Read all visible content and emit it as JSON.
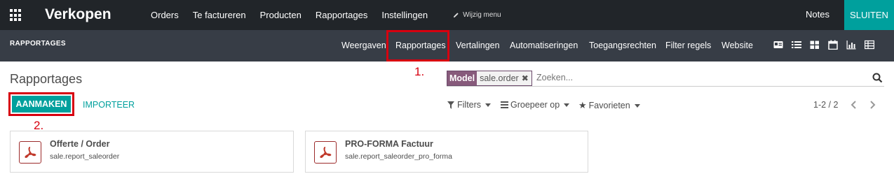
{
  "topbar": {
    "app_name": "Verkopen",
    "menu": [
      "Orders",
      "Te factureren",
      "Producten",
      "Rapportages",
      "Instellingen"
    ],
    "edit_menu": "Wijzig menu",
    "notes": "Notes",
    "close": "SLUITEN"
  },
  "subbar": {
    "title": "RAPPORTAGES",
    "nav": [
      "Weergaven",
      "Rapportages",
      "Vertalingen",
      "Automatiseringen",
      "Toegangsrechten",
      "Filter regels",
      "Website"
    ],
    "view_icons": [
      "contact-card-icon",
      "list-icon",
      "kanban-icon",
      "calendar-icon",
      "graph-icon",
      "pivot-icon"
    ]
  },
  "annotations": {
    "one": "1.",
    "two": "2."
  },
  "control": {
    "title": "Rapportages",
    "facet_label": "Model",
    "facet_value": "sale.order",
    "search_placeholder": "Zoeken...",
    "create": "AANMAKEN",
    "import": "IMPORTEER",
    "filters": "Filters",
    "group_by": "Groepeer op",
    "favorites": "Favorieten",
    "pager": "1-2 / 2"
  },
  "records": [
    {
      "name": "Offerte / Order",
      "report": "sale.report_saleorder"
    },
    {
      "name": "PRO-FORMA Factuur",
      "report": "sale.report_saleorder_pro_forma"
    }
  ],
  "colors": {
    "accent": "#00a09d",
    "highlight": "#d7000f",
    "facet": "#875a7b",
    "topbar": "#212529",
    "subbar": "#373d46"
  }
}
